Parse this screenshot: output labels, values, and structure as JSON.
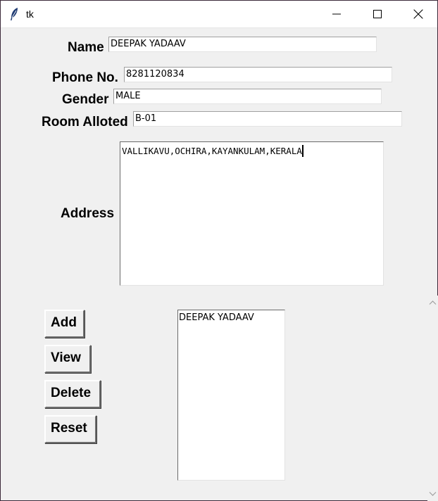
{
  "window": {
    "title": "tk"
  },
  "form": {
    "name_label": "Name",
    "name_value": "DEEPAK YADAAV",
    "phone_label": "Phone No.",
    "phone_value": "8281120834",
    "gender_label": "Gender",
    "gender_value": "MALE",
    "room_label": "Room Alloted",
    "room_value": "B-01",
    "address_label": "Address",
    "address_value": "VALLIKAVU,OCHIRA,KAYANKULAM,KERALA"
  },
  "buttons": {
    "add": "Add",
    "view": "View",
    "delete": "Delete",
    "reset": "Reset"
  },
  "listbox": {
    "items": [
      "DEEPAK YADAAV"
    ]
  },
  "icons": {
    "app": "feather-icon",
    "minimize": "minimize-icon",
    "maximize": "maximize-icon",
    "close": "close-icon",
    "scroll_up": "chevron-up-icon",
    "scroll_down": "chevron-down-icon"
  }
}
